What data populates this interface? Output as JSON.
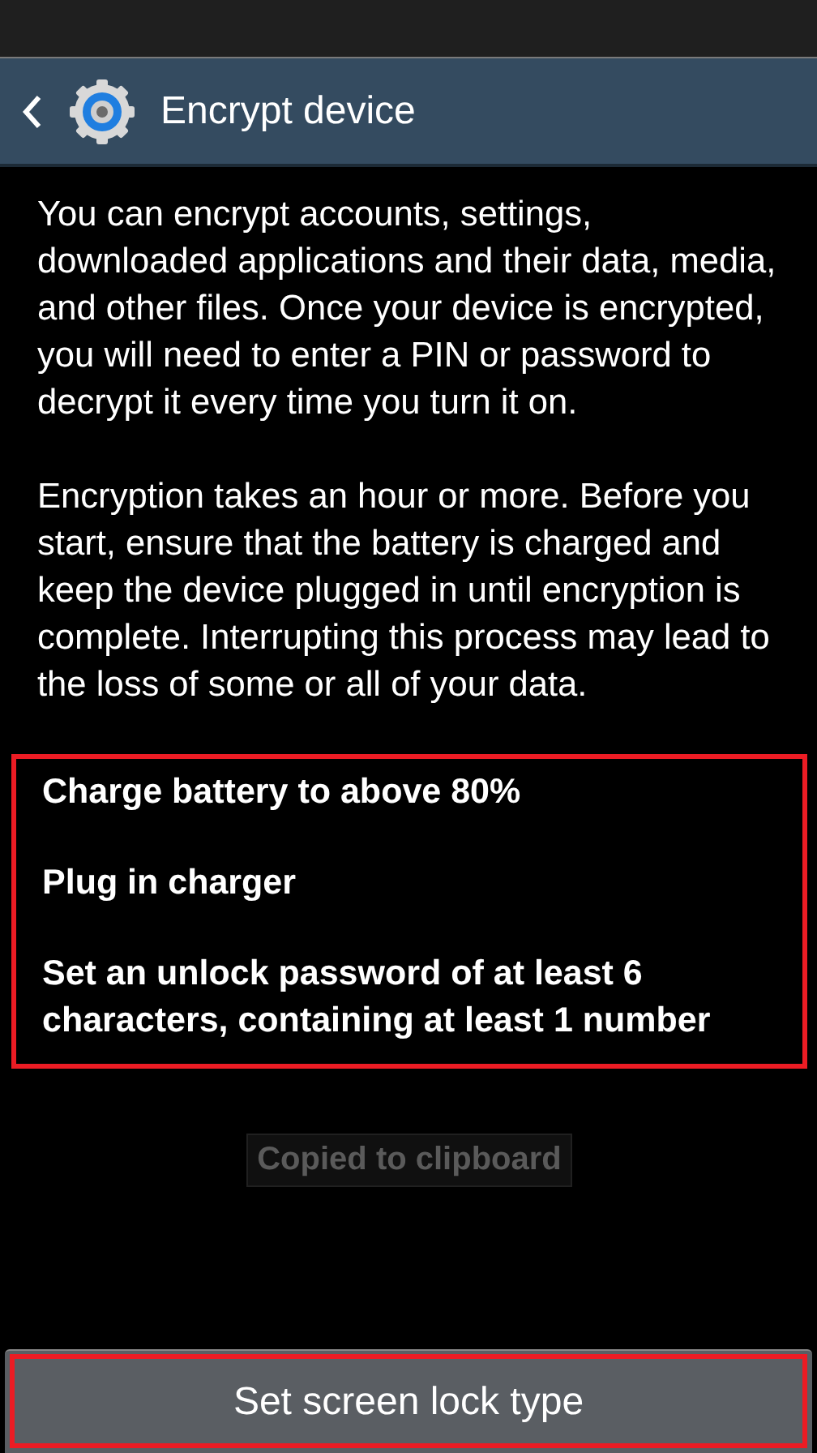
{
  "action_bar": {
    "title": "Encrypt device"
  },
  "paragraphs": [
    "You can encrypt accounts, settings, downloaded applications and their data, media, and other files. Once your device is encrypted, you will need to enter a PIN or password to decrypt it every time you turn it on.",
    "Encryption takes an hour or more. Before you start, ensure that the battery is charged and keep the device plugged in until encryption is complete. Interrupting this process may lead to the loss of some or all of your data."
  ],
  "requirements": {
    "highlighted": true,
    "items": [
      "Charge battery to above 80%",
      "Plug in charger",
      "Set an unlock password of at least 6 characters, containing at least 1 number"
    ]
  },
  "toast": "Copied to clipboard",
  "button": {
    "label": "Set screen lock type",
    "highlighted": true
  }
}
